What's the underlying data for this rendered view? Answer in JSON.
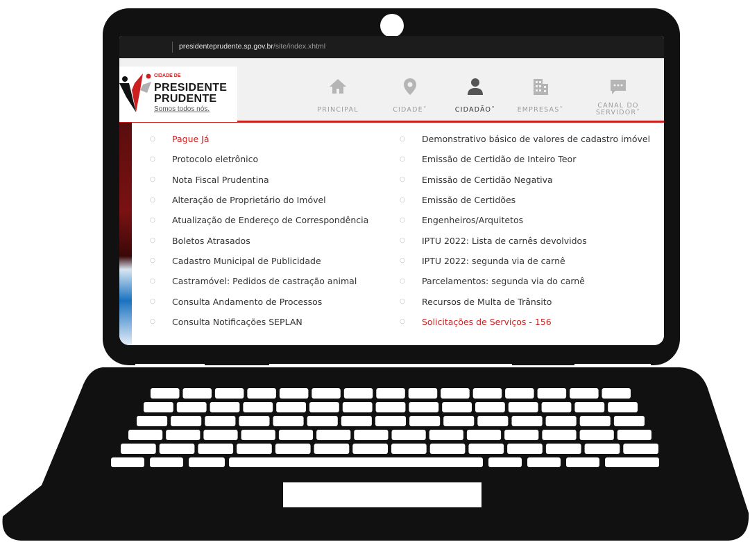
{
  "browser": {
    "host": "presidenteprudente.sp.gov.br",
    "path": "/site/index.xhtml"
  },
  "logo": {
    "small": "CIDADE DE",
    "line1": "PRESIDENTE",
    "line2": "PRUDENTE",
    "slogan": "Somos todos nós."
  },
  "nav": [
    {
      "label": "PRINCIPAL",
      "icon": "home-icon"
    },
    {
      "label": "CIDADE˅",
      "icon": "map-pin-icon"
    },
    {
      "label": "CIDADÃO˅",
      "icon": "person-icon"
    },
    {
      "label": "EMPRESAS˅",
      "icon": "building-icon"
    },
    {
      "label": "CANAL DO SERVIDOR˅",
      "icon": "chat-icon"
    }
  ],
  "menu": {
    "column1": [
      "Pague Já",
      "Protocolo eletrônico",
      "Nota Fiscal Prudentina",
      "Alteração de Proprietário do Imóvel",
      "Atualização de Endereço de Correspondência",
      "Boletos Atrasados",
      "Cadastro Municipal de Publicidade",
      "Castramóvel: Pedidos de castração animal",
      "Consulta Andamento de Processos",
      "Consulta Notificações SEPLAN"
    ],
    "column2": [
      "Demonstrativo básico de valores de cadastro imóvel",
      "Emissão de Certidão de Inteiro Teor",
      "Emissão de Certidão Negativa",
      "Emissão de Certidões",
      "Engenheiros/Arquitetos",
      "IPTU 2022: Lista de carnês devolvidos",
      "IPTU 2022: segunda via de carnê",
      "Parcelamentos: segunda via do carnê",
      "Recursos de Multa de Trânsito",
      "Solicitações de Serviços - 156"
    ]
  },
  "colors": {
    "accent": "#cc1f1f",
    "frame": "#111111",
    "header_bg": "#f1f1f1"
  }
}
